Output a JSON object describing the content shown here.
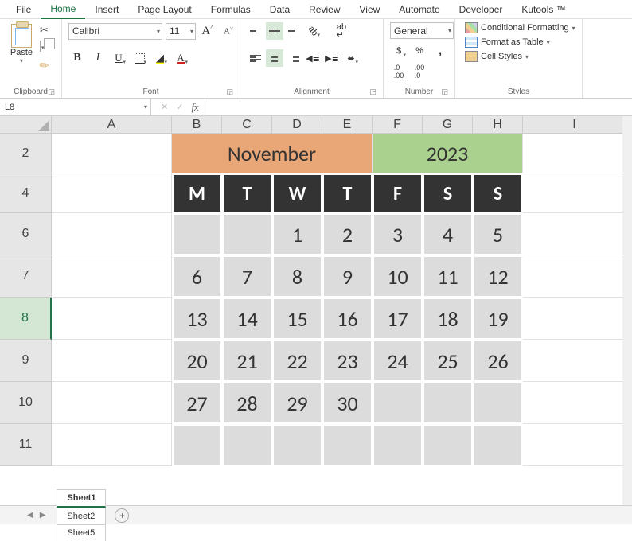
{
  "menu": [
    "File",
    "Home",
    "Insert",
    "Page Layout",
    "Formulas",
    "Data",
    "Review",
    "View",
    "Automate",
    "Developer",
    "Kutools ™"
  ],
  "active_menu": 1,
  "ribbon": {
    "clipboard": {
      "paste": "Paste",
      "label": "Clipboard"
    },
    "font": {
      "name": "Calibri",
      "size": "11",
      "label": "Font"
    },
    "align": {
      "label": "Alignment"
    },
    "number": {
      "format": "General",
      "label": "Number"
    },
    "styles": {
      "cond": "Conditional Formatting",
      "tbl": "Format as Table",
      "cell": "Cell Styles",
      "label": "Styles"
    }
  },
  "namebox": "L8",
  "cols": [
    "A",
    "B",
    "C",
    "D",
    "E",
    "F",
    "G",
    "H",
    "I"
  ],
  "rows": [
    "2",
    "4",
    "6",
    "7",
    "8",
    "9",
    "10",
    "11"
  ],
  "calendar": {
    "month": "November",
    "year": "2023",
    "days": [
      "M",
      "T",
      "W",
      "T",
      "F",
      "S",
      "S"
    ],
    "grid": [
      [
        "",
        "",
        "1",
        "2",
        "3",
        "4",
        "5"
      ],
      [
        "6",
        "7",
        "8",
        "9",
        "10",
        "11",
        "12"
      ],
      [
        "13",
        "14",
        "15",
        "16",
        "17",
        "18",
        "19"
      ],
      [
        "20",
        "21",
        "22",
        "23",
        "24",
        "25",
        "26"
      ],
      [
        "27",
        "28",
        "29",
        "30",
        "",
        "",
        ""
      ],
      [
        "",
        "",
        "",
        "",
        "",
        "",
        ""
      ]
    ]
  },
  "tabs": [
    "Sheet1",
    "Sheet2",
    "Sheet5"
  ],
  "active_tab": 0,
  "chart_data": {
    "type": "table",
    "title": "November 2023",
    "columns": [
      "M",
      "T",
      "W",
      "T",
      "F",
      "S",
      "S"
    ],
    "rows": [
      [
        "",
        "",
        "1",
        "2",
        "3",
        "4",
        "5"
      ],
      [
        "6",
        "7",
        "8",
        "9",
        "10",
        "11",
        "12"
      ],
      [
        "13",
        "14",
        "15",
        "16",
        "17",
        "18",
        "19"
      ],
      [
        "20",
        "21",
        "22",
        "23",
        "24",
        "25",
        "26"
      ],
      [
        "27",
        "28",
        "29",
        "30",
        "",
        "",
        ""
      ],
      [
        "",
        "",
        "",
        "",
        "",
        "",
        ""
      ]
    ]
  }
}
